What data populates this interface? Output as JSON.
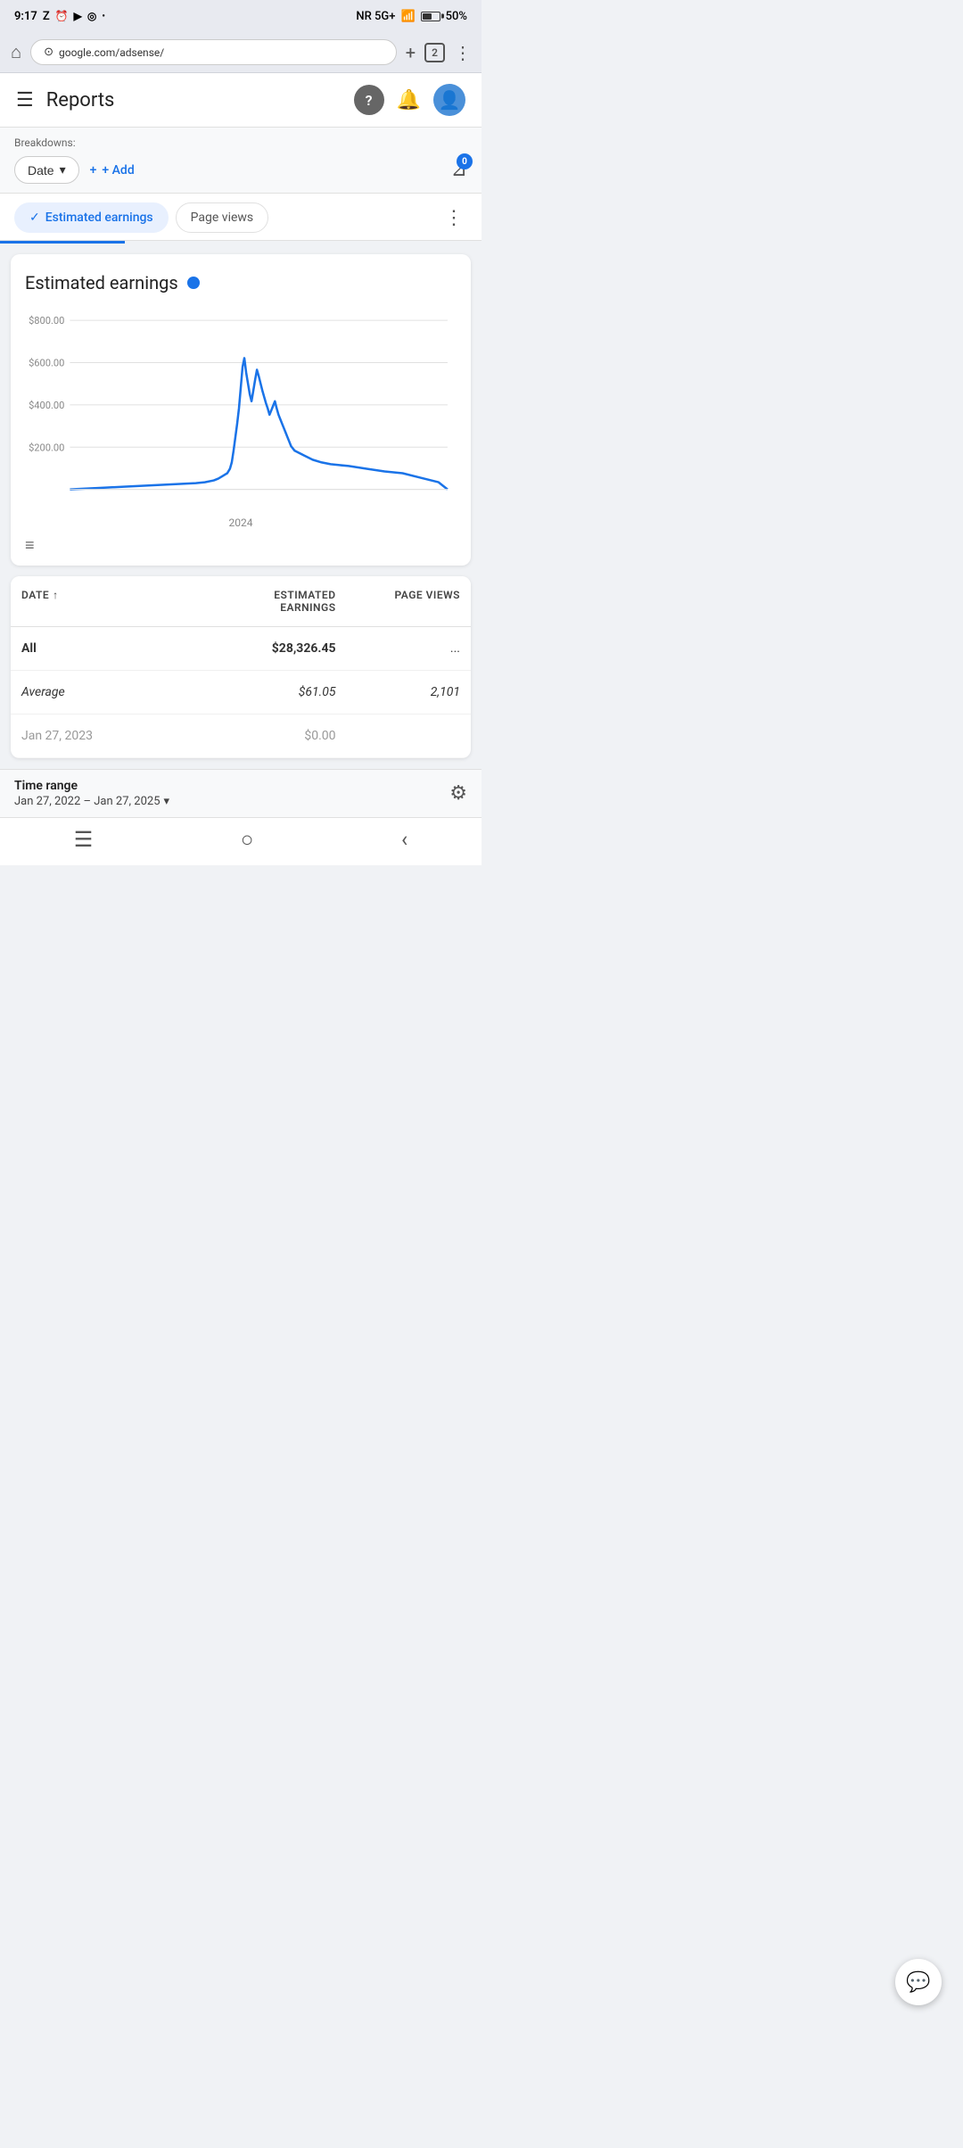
{
  "status_bar": {
    "time": "9:17",
    "icons_left": [
      "Z",
      "🔔",
      "▶",
      "◎",
      "•"
    ],
    "signal": "NR 5G+",
    "battery": "50%"
  },
  "browser": {
    "url": "google.com/adsense/",
    "tab_count": "2"
  },
  "header": {
    "title": "Reports",
    "help_label": "?",
    "bell_label": "🔔"
  },
  "filter": {
    "breakdowns_label": "Breakdowns:",
    "date_btn": "Date",
    "add_btn": "+ Add",
    "badge_count": "0"
  },
  "metric_tabs": [
    {
      "label": "Estimated earnings",
      "active": true
    },
    {
      "label": "Page views",
      "active": false
    }
  ],
  "chart": {
    "title": "Estimated earnings",
    "y_labels": [
      "$800.00",
      "$600.00",
      "$400.00",
      "$200.00"
    ],
    "x_label": "2024",
    "color": "#1a73e8"
  },
  "table": {
    "col1": "DATE",
    "col2_line1": "Estimated",
    "col2_line2": "earnings",
    "col3": "Page views",
    "rows": [
      {
        "date": "All",
        "earnings": "$28,326.45",
        "pageviews": "...",
        "date_bold": true,
        "earnings_bold": true
      },
      {
        "date": "Average",
        "earnings": "$61.05",
        "pageviews": "2,101",
        "date_italic": true,
        "earnings_italic": true,
        "pageviews_italic": true
      }
    ],
    "last_date_label": "Jan 27, 2023",
    "last_earnings": "$0.00"
  },
  "bottom": {
    "time_range_label": "Time range",
    "time_range_value": "Jan 27, 2022 – Jan 27, 2025"
  },
  "nav": {
    "menu_icon": "☰",
    "circle_icon": "○",
    "back_icon": "‹"
  }
}
